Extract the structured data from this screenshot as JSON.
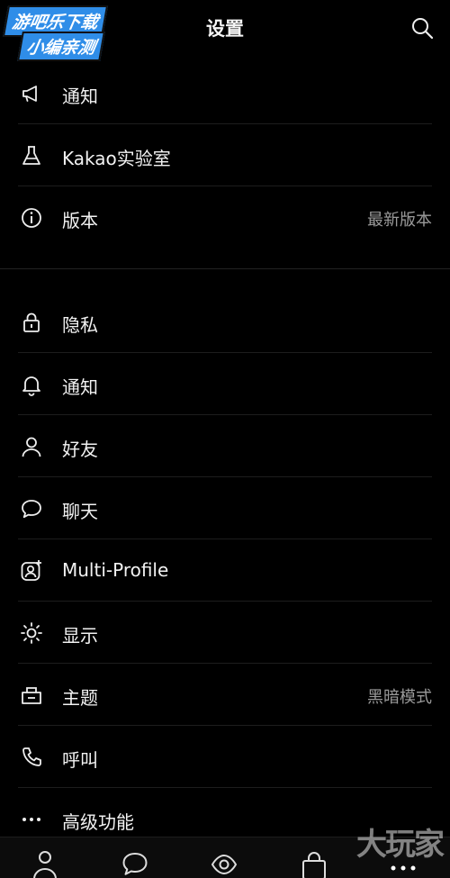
{
  "watermark": {
    "line1": "游吧乐下载",
    "line2": "小编亲测",
    "corner": "大玩家"
  },
  "header": {
    "title": "设置",
    "search_icon": "search-icon"
  },
  "groups": [
    {
      "items": [
        {
          "label": "通知",
          "icon": "megaphone-icon"
        },
        {
          "label": "Kakao实验室",
          "icon": "flask-icon"
        },
        {
          "label": "版本",
          "icon": "info-icon",
          "value": "最新版本"
        }
      ]
    },
    {
      "items": [
        {
          "label": "隐私",
          "icon": "lock-icon"
        },
        {
          "label": "通知",
          "icon": "bell-icon"
        },
        {
          "label": "好友",
          "icon": "person-icon"
        },
        {
          "label": "聊天",
          "icon": "chat-bubble-icon"
        },
        {
          "label": "Multi-Profile",
          "icon": "multi-profile-icon"
        },
        {
          "label": "显示",
          "icon": "brightness-icon"
        },
        {
          "label": "主题",
          "icon": "theme-icon",
          "value": "黑暗模式"
        },
        {
          "label": "呼叫",
          "icon": "phone-icon"
        },
        {
          "label": "高级功能",
          "icon": "more-dots-icon"
        }
      ]
    }
  ],
  "tabbar": {
    "tabs": [
      {
        "icon": "friends-tab-icon"
      },
      {
        "icon": "chats-tab-icon"
      },
      {
        "icon": "view-tab-icon"
      },
      {
        "icon": "shopping-tab-icon"
      },
      {
        "icon": "more-tab-icon"
      }
    ]
  }
}
